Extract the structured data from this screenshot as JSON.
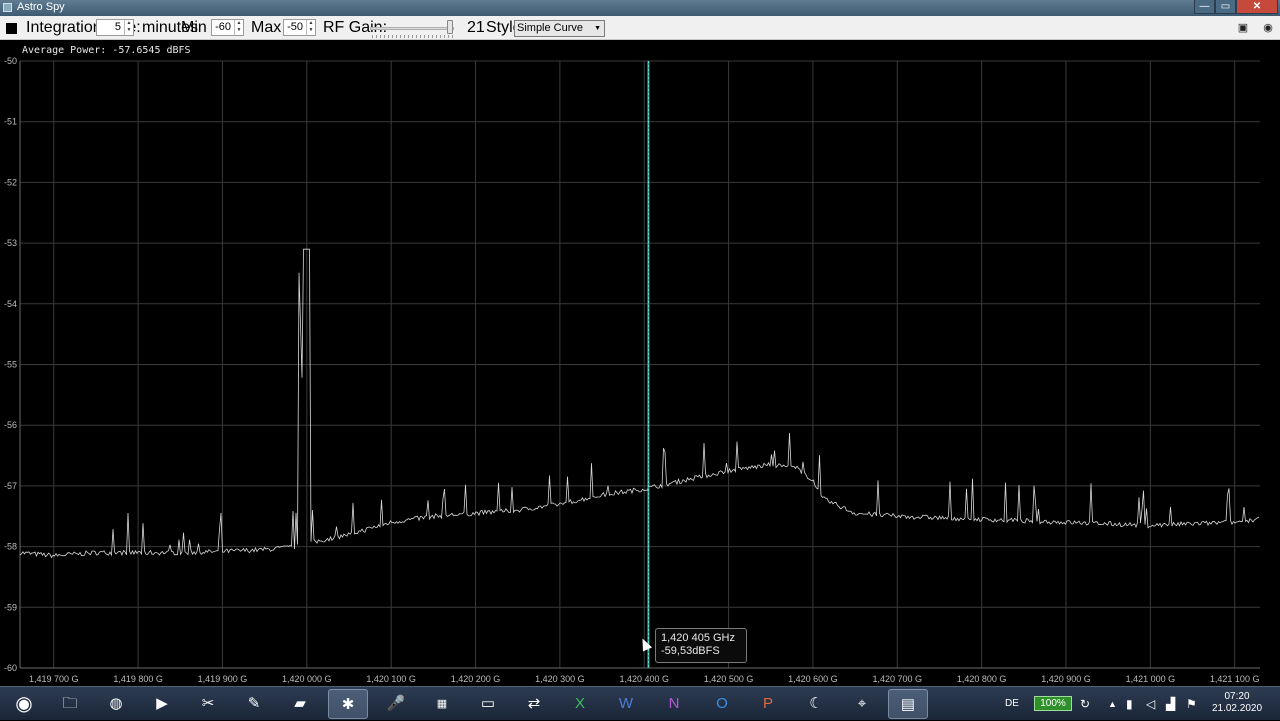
{
  "window": {
    "title": "Astro Spy",
    "min_glyph": "—",
    "max_glyph": "▭",
    "close_glyph": "✕"
  },
  "toolbar": {
    "integration_label": "Integration time:",
    "integration_value": "5",
    "integration_unit": "minutes",
    "min_y_label": "Min Y:",
    "min_y_value": "-60",
    "max_y_label": "Max Y:",
    "max_y_value": "-50",
    "rf_gain_label": "RF Gain:",
    "rf_gain_value": "21",
    "rf_gain_level": 21,
    "style_label": "Style:",
    "style_value": "Simple Curve",
    "icons": [
      "stop-icon",
      "export-excel-icon",
      "camera-icon"
    ]
  },
  "average_power": "Average Power: -57.6545 dBFS",
  "tooltip": {
    "frequency": "1,420 405 GHz",
    "power": "-59,53dBFS"
  },
  "chart_data": {
    "type": "line",
    "xlabel": "",
    "ylabel": "",
    "ylim": [
      -60,
      -50
    ],
    "xlim": [
      1.41966,
      1.42113
    ],
    "grid": true,
    "y_ticks": [
      "-50",
      "-51",
      "-52",
      "-53",
      "-54",
      "-55",
      "-56",
      "-57",
      "-58",
      "-59",
      "-60"
    ],
    "x_ticks": [
      "1,419 700 G",
      "1,419 800 G",
      "1,419 900 G",
      "1,420 000 G",
      "1,420 100 G",
      "1,420 200 G",
      "1,420 300 G",
      "1,420 400 G",
      "1,420 500 G",
      "1,420 600 G",
      "1,420 700 G",
      "1,420 800 G",
      "1,420 900 G",
      "1,421 000 G",
      "1,421 100 G"
    ],
    "x_tick_values": [
      1.4197,
      1.4198,
      1.4199,
      1.42,
      1.4201,
      1.4202,
      1.4203,
      1.4204,
      1.4205,
      1.4206,
      1.4207,
      1.4208,
      1.4209,
      1.421,
      1.4211
    ],
    "cursor_x": 1.420405,
    "series": [
      {
        "x": [
          1.41966,
          1.4197,
          1.41975,
          1.4198,
          1.41985,
          1.4199,
          1.41995,
          1.41999,
          1.41999,
          1.42,
          1.42005,
          1.4201,
          1.42015,
          1.4202,
          1.42025,
          1.4203,
          1.42035,
          1.4204,
          1.42045,
          1.4205,
          1.42055,
          1.42058,
          1.4206,
          1.42061,
          1.42065,
          1.4207,
          1.4208,
          1.4209,
          1.421,
          1.4211,
          1.42113
        ],
        "values": [
          -58.1,
          -58.15,
          -58.1,
          -58.1,
          -58.1,
          -58.08,
          -58.05,
          -58.0,
          -53.1,
          -57.95,
          -57.8,
          -57.6,
          -57.5,
          -57.45,
          -57.4,
          -57.3,
          -57.15,
          -57.05,
          -56.9,
          -56.75,
          -56.65,
          -56.7,
          -56.9,
          -57.2,
          -57.45,
          -57.5,
          -57.55,
          -57.6,
          -57.65,
          -57.6,
          -57.55
        ]
      }
    ]
  }
}
